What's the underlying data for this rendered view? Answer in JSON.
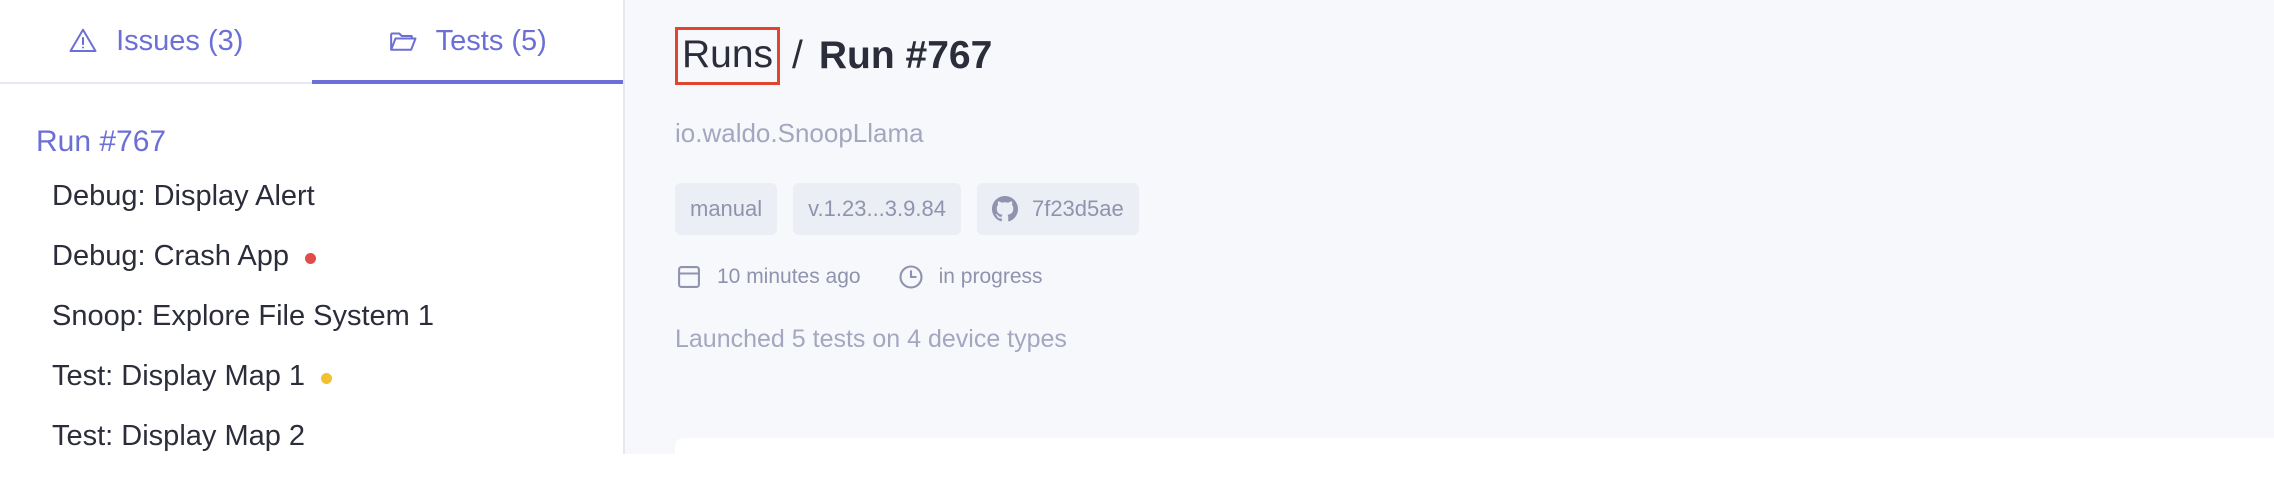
{
  "sidebar": {
    "tabs": [
      {
        "label": "Issues (3)",
        "icon": "warning-icon"
      },
      {
        "label": "Tests (5)",
        "icon": "folder-open-icon"
      }
    ],
    "run_title": "Run #767",
    "tests": [
      {
        "label": "Debug: Display Alert",
        "status": ""
      },
      {
        "label": "Debug: Crash App",
        "status": "error"
      },
      {
        "label": "Snoop: Explore File System 1",
        "status": ""
      },
      {
        "label": "Test: Display Map 1",
        "status": "warning"
      },
      {
        "label": "Test: Display Map 2",
        "status": ""
      }
    ]
  },
  "main": {
    "breadcrumb": {
      "link": "Runs",
      "separator": "/",
      "current": "Run #767"
    },
    "app_id": "io.waldo.SnoopLlama",
    "tags": {
      "trigger": "manual",
      "version": "v.1.23...3.9.84",
      "commit": "7f23d5ae"
    },
    "meta": {
      "time": "10 minutes ago",
      "status": "in progress"
    },
    "summary": "Launched 5 tests on 4 device types"
  },
  "colors": {
    "accent": "#6b6fd6",
    "error_dot": "#e34b4b",
    "warning_dot": "#f2c12e",
    "highlight_border": "#e0452f"
  }
}
